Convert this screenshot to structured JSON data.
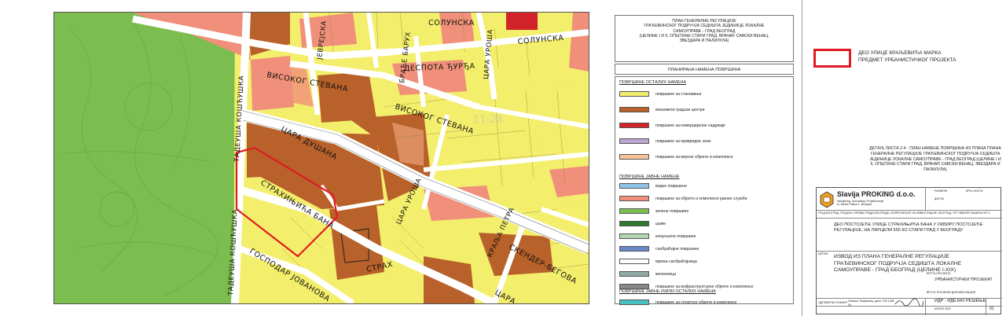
{
  "street_labels": [
    {
      "id": "solunska-1",
      "text": "СОЛУНСКА"
    },
    {
      "id": "solunska-2",
      "text": "СОЛУНСКА"
    },
    {
      "id": "jevrejska",
      "text": "ЈЕВРЕЈСКА"
    },
    {
      "id": "baruh",
      "text": "БРАЋЕ БАРУХ"
    },
    {
      "id": "urosa-1",
      "text": "ЦАРА УРОША"
    },
    {
      "id": "visokog-1",
      "text": "ВИСОКОГ СТЕВАНА"
    },
    {
      "id": "despota",
      "text": "ДЕСПОТА ЂУРЂА"
    },
    {
      "id": "tadeusa-1",
      "text": "ТАДЕУША КОШЋУШКА"
    },
    {
      "id": "visokog-2",
      "text": "ВИСОКОГ СТЕВАНА"
    },
    {
      "id": "dusana",
      "text": "ЦАРА ДУШАНА"
    },
    {
      "id": "urosa-2",
      "text": "ЦАРА УРОША"
    },
    {
      "id": "strahinjica",
      "text": "СТРАХИЊИЋА БАНА"
    },
    {
      "id": "kralja-petra",
      "text": "КРАЉА ПЕТРА"
    },
    {
      "id": "skender",
      "text": "СКЕНДЕР-БЕГОВА"
    },
    {
      "id": "tadeusa-2",
      "text": "ТАДЕУША КОШЋУШКА"
    },
    {
      "id": "gospodar",
      "text": "ГОСПОДАР ЈОВАНОВА"
    },
    {
      "id": "strahinjica-2",
      "text": "СТРАХ"
    },
    {
      "id": "cara-2",
      "text": "ЦАРА"
    }
  ],
  "map_number": "11-28",
  "panel": {
    "title": "ПЛАН ГЕНЕРАЛНЕ РЕГУЛАЦИЈЕ\nГРАЂЕВИНСКОГ ПОДРУЧЈА СЕДИШТА ЈЕДИНИЦЕ ЛОКАЛНЕ\nСАМОУПРАВЕ - ГРАД БЕОГРАД\n(ЦЕЛИНЕ I И II, ОПШТИНЕ СТАРИ ГРАД, ВРАЧАР, САВСКИ ВЕНАЦ,\nЗВЕЗДАРА И ПАЛИЛУЛА)",
    "subtitle": "ПЛАНИРАНА НАМЕНА ПОВРШИНА"
  },
  "legend": {
    "group1": "ПОВРШИНЕ ОСТАЛИХ НАМЕНА",
    "items1": [
      {
        "label": "површине за становање",
        "color": "#f3ee6b"
      },
      {
        "label": "мешовити градски центри",
        "color": "#b8612a"
      },
      {
        "label": "површине за комерцијалне садржаје",
        "color": "#d2232a"
      },
      {
        "label": "површине за привредне зоне",
        "color": "#b9a5cf"
      },
      {
        "label": "површине за верске објекте и комплексе",
        "color": "#f6c39a"
      }
    ],
    "group2": "ПОВРШИНЕ ЈАВНЕ НАМЕНЕ",
    "items2": [
      {
        "label": "водне површине",
        "color": "#8ec4ea"
      },
      {
        "label": "површине за објекте и комплексе јавних служби",
        "color": "#f0907a"
      },
      {
        "label": "зелене површине",
        "color": "#7bbd4f"
      },
      {
        "label": "шуме",
        "color": "#2e7a2e"
      },
      {
        "label": "комуналне површине",
        "color": "#b3d4b0"
      },
      {
        "label": "саобраћајне површине",
        "color": "#6b88c8"
      },
      {
        "label": "мрежа саобраћајница",
        "color": "#ffffff"
      },
      {
        "label": "железница",
        "color": "#8fa9a4"
      },
      {
        "label": "површине за инфраструктурне објекте и комплексе",
        "color": "#888888"
      }
    ],
    "group3": "ПОВРШИНЕ ЈАВНЕ И/ИЛИ ОСТАЛИХ НАМЕНА",
    "items3": [
      {
        "label": "површине за спортске објекте и комплексе",
        "color": "#47c2c2"
      }
    ]
  },
  "key": {
    "text": "ДЕО УЛИЦЕ КРАЉЕВИЋА МАРКА\nПРЕДМЕТ УРБАНИСТИЧКОГ ПРОЈЕКТА",
    "color": "#e01b24"
  },
  "detail": "ДЕТАЉ ЛИСТА 2-4 - ПЛАН НАМЕНЕ ПОВРШИНА ИЗ ПЛАНА ПЛАНА ГЕНЕРАЛНЕ РЕГУЛАЦИЈЕ ГРАЂЕВИНСКОГ ПОДРУЧЈА СЕДИШТА ЈЕДИНИЦЕ ЛОКАЛНЕ САМОУПРАВЕ - ГРАД БЕОГРАД (ЦЕЛИНЕ I И II, ОПШТИНЕ СТАРИ ГРАД, ВРАЧАР, САВСКИ ВЕНАЦ, ЗВЕЗДАРА И ПАЛИЛУЛА)",
  "title_block": {
    "company": "Slavija PROKING d.o.o.",
    "company_sub": "Inženjering, Konsalting i Projektovanje\nul. Nikole Pašića 1, Beograd",
    "client": "ГРАД БЕОГРАД, ГРАДСКА УПРАВА ГРАДА БЕОГРАДА, СЕКРЕТАРИЈАТ ЗА ИНВЕСТИЦИЈЕ, БЕОГРАД, ТРГ НИКОЛЕ ПАШИЋА БР. 6",
    "object": "ДЕО ПОСТОЈЕЋЕ УЛИЦЕ СТРАХИЊИЋА БАНА У ОКВИРУ ПОСТОЈЕЋЕ РЕГУЛАЦИЈЕ, НА ПАРЦЕЛИ 555 КО СТАРИ ГРАД У БЕОГРАДУ",
    "drawing_label": "ЦРТЕЖ",
    "drawing": "ИЗВОД ИЗ ПЛАНА ГЕНЕРАЛНЕ РЕГУЛАЦИЈЕ ГРАЂЕВИНСКОГ ПОДРУЧЈА СЕДИШТА ЛОКАЛНЕ САМОУПРАВЕ - ГРАД БЕОГРАД (ЦЕЛИНЕ I-XIX)",
    "responsible_label": "ОДГОВОРНИ ПЛАНЕР",
    "responsible": "Синиша Темеринац, дипл.\n200 1068 03",
    "phase_label": "ВРСТА ПРОЈЕКТА",
    "phase": "УРБАНИСТИЧКИ ПРОЈЕКАТ",
    "stage_label": "ВРСТА ТЕХНИЧКЕ ДОКУМЕНТАЦИЈЕ",
    "stage": "ИДР - ИДЕЈНО РЕШЕЊЕ",
    "date": "АПРИЛ 2022",
    "sheet": "01",
    "scale_label": "РАЗМЕРА",
    "date_label": "ДАТУМ",
    "sheet_label": "БРОЈ ЛИСТА"
  }
}
